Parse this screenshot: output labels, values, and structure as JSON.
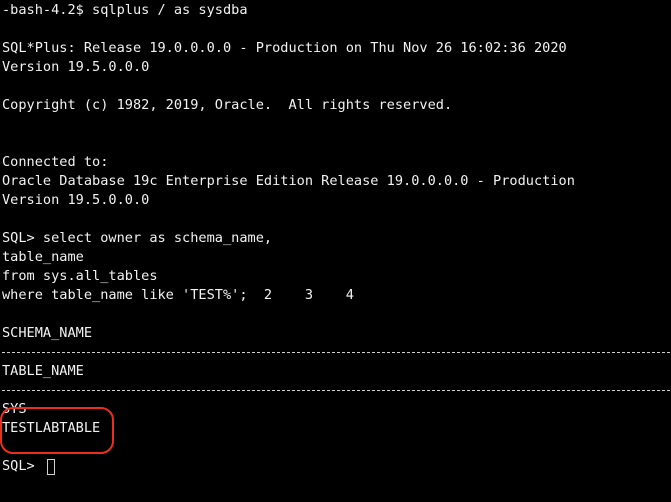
{
  "terminal": {
    "lines": {
      "l1": "-bash-4.2$ sqlplus / as sysdba",
      "l3": "SQL*Plus: Release 19.0.0.0.0 - Production on Thu Nov 26 16:02:36 2020",
      "l4": "Version 19.5.0.0.0",
      "l6": "Copyright (c) 1982, 2019, Oracle.  All rights reserved.",
      "l9": "Connected to:",
      "l10": "Oracle Database 19c Enterprise Edition Release 19.0.0.0.0 - Production",
      "l11": "Version 19.5.0.0.0",
      "l13": "SQL> select owner as schema_name,",
      "l14": "table_name",
      "l15": "from sys.all_tables",
      "l16": "where table_name like 'TEST%';  2    3    4",
      "l18": "SCHEMA_NAME",
      "l20": "TABLE_NAME",
      "l22": "SYS",
      "l23": "TESTLABTABLE",
      "l25": "SQL> "
    },
    "colors": {
      "background": "#000000",
      "text": "#f2f2f2",
      "highlight": "#e8301c"
    }
  }
}
